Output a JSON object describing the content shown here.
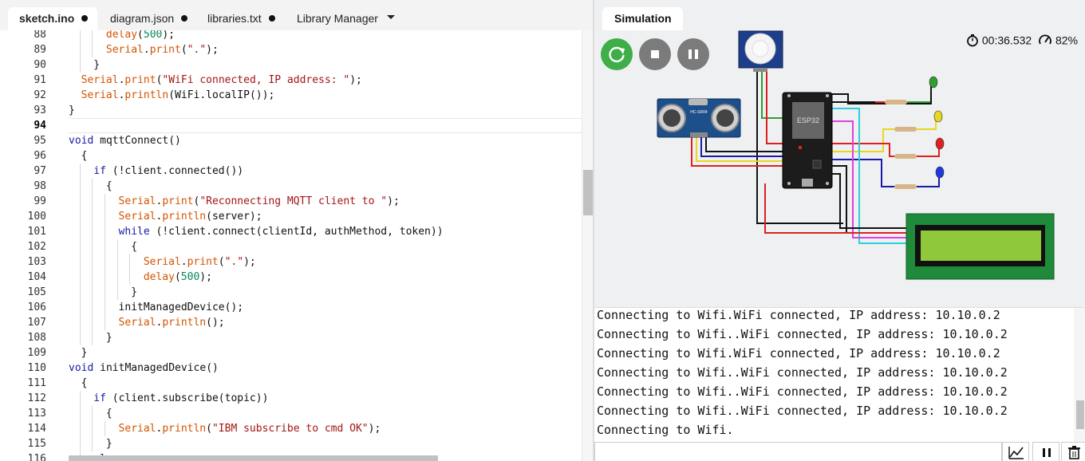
{
  "tabs": [
    {
      "label": "sketch.ino",
      "modified": true,
      "active": true
    },
    {
      "label": "diagram.json",
      "modified": true,
      "active": false
    },
    {
      "label": "libraries.txt",
      "modified": true,
      "active": false
    },
    {
      "label": "Library Manager",
      "modified": false,
      "active": false
    }
  ],
  "editor": {
    "current_line": 94,
    "lines": [
      {
        "n": 88,
        "indent": 1,
        "tokens": [
          [
            "obj",
            "delay"
          ],
          [
            "t",
            "("
          ],
          [
            "num",
            "500"
          ],
          [
            "t",
            ");"
          ]
        ]
      },
      {
        "n": 89,
        "indent": 1,
        "tokens": [
          [
            "obj",
            "Serial"
          ],
          [
            "t",
            "."
          ],
          [
            "obj",
            "print"
          ],
          [
            "t",
            "("
          ],
          [
            "str",
            "\".\""
          ],
          [
            "t",
            ");"
          ]
        ]
      },
      {
        "n": 90,
        "indent": 1,
        "tokens": [
          [
            "t",
            "}"
          ]
        ]
      },
      {
        "n": 91,
        "indent": 0,
        "tokens": [
          [
            "obj",
            "Serial"
          ],
          [
            "t",
            "."
          ],
          [
            "obj",
            "print"
          ],
          [
            "t",
            "("
          ],
          [
            "str",
            "\"WiFi connected, IP address: \""
          ],
          [
            "t",
            ");"
          ]
        ]
      },
      {
        "n": 92,
        "indent": 0,
        "tokens": [
          [
            "obj",
            "Serial"
          ],
          [
            "t",
            "."
          ],
          [
            "obj",
            "println"
          ],
          [
            "t",
            "(WiFi.localIP());"
          ]
        ]
      },
      {
        "n": 93,
        "indent": 0,
        "tokens": [
          [
            "t",
            "}"
          ]
        ]
      },
      {
        "n": 94,
        "indent": 0,
        "tokens": []
      },
      {
        "n": 95,
        "indent": 0,
        "tokens": [
          [
            "kw",
            "void"
          ],
          [
            "t",
            " mqttConnect()"
          ]
        ]
      },
      {
        "n": 96,
        "indent": 0,
        "tokens": [
          [
            "t",
            "{"
          ]
        ]
      },
      {
        "n": 97,
        "indent": 0,
        "tokens": [
          [
            "kw",
            "if"
          ],
          [
            "t",
            " (!client.connected())"
          ]
        ]
      },
      {
        "n": 98,
        "indent": 1,
        "tokens": [
          [
            "t",
            "{"
          ]
        ]
      },
      {
        "n": 99,
        "indent": 1,
        "tokens": [
          [
            "obj",
            "Serial"
          ],
          [
            "t",
            "."
          ],
          [
            "obj",
            "print"
          ],
          [
            "t",
            "("
          ],
          [
            "str",
            "\"Reconnecting MQTT client to \""
          ],
          [
            "t",
            ");"
          ]
        ]
      },
      {
        "n": 100,
        "indent": 1,
        "tokens": [
          [
            "obj",
            "Serial"
          ],
          [
            "t",
            "."
          ],
          [
            "obj",
            "println"
          ],
          [
            "t",
            "(server);"
          ]
        ]
      },
      {
        "n": 101,
        "indent": 1,
        "tokens": [
          [
            "kw",
            "while"
          ],
          [
            "t",
            " (!client.connect(clientId, authMethod, token))"
          ]
        ]
      },
      {
        "n": 102,
        "indent": 2,
        "tokens": [
          [
            "t",
            "{"
          ]
        ]
      },
      {
        "n": 103,
        "indent": 2,
        "tokens": [
          [
            "obj",
            "Serial"
          ],
          [
            "t",
            "."
          ],
          [
            "obj",
            "print"
          ],
          [
            "t",
            "("
          ],
          [
            "str",
            "\".\""
          ],
          [
            "t",
            ");"
          ]
        ]
      },
      {
        "n": 104,
        "indent": 2,
        "tokens": [
          [
            "obj",
            "delay"
          ],
          [
            "t",
            "("
          ],
          [
            "num",
            "500"
          ],
          [
            "t",
            ");"
          ]
        ]
      },
      {
        "n": 105,
        "indent": 2,
        "tokens": [
          [
            "t",
            "}"
          ]
        ]
      },
      {
        "n": 106,
        "indent": 1,
        "tokens": [
          [
            "t",
            "initManagedDevice();"
          ]
        ]
      },
      {
        "n": 107,
        "indent": 1,
        "tokens": [
          [
            "obj",
            "Serial"
          ],
          [
            "t",
            "."
          ],
          [
            "obj",
            "println"
          ],
          [
            "t",
            "();"
          ]
        ]
      },
      {
        "n": 108,
        "indent": 1,
        "tokens": [
          [
            "t",
            "}"
          ]
        ]
      },
      {
        "n": 109,
        "indent": 0,
        "tokens": [
          [
            "t",
            "}"
          ]
        ]
      },
      {
        "n": 110,
        "indent": 0,
        "tokens": [
          [
            "kw",
            "void"
          ],
          [
            "t",
            " initManagedDevice()"
          ]
        ]
      },
      {
        "n": 111,
        "indent": 0,
        "tokens": [
          [
            "t",
            "{"
          ]
        ]
      },
      {
        "n": 112,
        "indent": 0,
        "tokens": [
          [
            "kw",
            "if"
          ],
          [
            "t",
            " (client.subscribe(topic))"
          ]
        ]
      },
      {
        "n": 113,
        "indent": 1,
        "tokens": [
          [
            "t",
            "{"
          ]
        ]
      },
      {
        "n": 114,
        "indent": 1,
        "tokens": [
          [
            "obj",
            "Serial"
          ],
          [
            "t",
            "."
          ],
          [
            "obj",
            "println"
          ],
          [
            "t",
            "("
          ],
          [
            "str",
            "\"IBM subscribe to cmd OK\""
          ],
          [
            "t",
            ");"
          ]
        ]
      },
      {
        "n": 115,
        "indent": 1,
        "tokens": [
          [
            "t",
            "}"
          ]
        ]
      },
      {
        "n": 116,
        "indent": 0,
        "tokens": [
          [
            "kw",
            "else"
          ]
        ]
      }
    ]
  },
  "simulation": {
    "tab_label": "Simulation",
    "timer": "00:36.532",
    "speed": "82%",
    "components": {
      "mcu_label": "ESP32",
      "ultrasonic_label": "HC-SR04",
      "led_colors": [
        "#2e9e2e",
        "#e6d820",
        "#e02020",
        "#2038e0"
      ]
    }
  },
  "serial": {
    "lines": [
      "Connecting to Wifi.WiFi connected, IP address: 10.10.0.2",
      "Connecting to Wifi..WiFi connected, IP address: 10.10.0.2",
      "Connecting to Wifi.WiFi connected, IP address: 10.10.0.2",
      "Connecting to Wifi..WiFi connected, IP address: 10.10.0.2",
      "Connecting to Wifi..WiFi connected, IP address: 10.10.0.2",
      "Connecting to Wifi..WiFi connected, IP address: 10.10.0.2",
      "Connecting to Wifi."
    ],
    "input_value": ""
  }
}
